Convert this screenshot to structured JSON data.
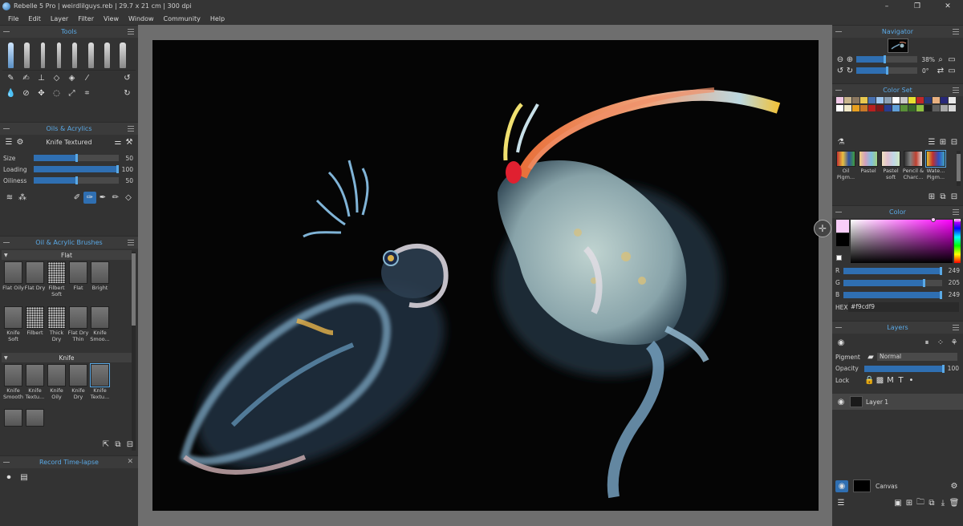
{
  "window": {
    "title": "Rebelle 5 Pro | weirdlilguys.reb | 29.7 x 21 cm | 300 dpi",
    "minimize": "–",
    "restore": "❐",
    "close": "✕"
  },
  "menu": [
    "File",
    "Edit",
    "Layer",
    "Filter",
    "View",
    "Window",
    "Community",
    "Help"
  ],
  "tools": {
    "title": "Tools"
  },
  "oils": {
    "title": "Oils & Acrylics",
    "preset": "Knife Textured",
    "sliders": [
      {
        "label": "Size",
        "value": "50",
        "pct": 0.5
      },
      {
        "label": "Loading",
        "value": "100",
        "pct": 1.0
      },
      {
        "label": "Oiliness",
        "value": "50",
        "pct": 0.5
      }
    ]
  },
  "brushes": {
    "title": "Oil & Acrylic Brushes",
    "categories": [
      {
        "name": "Flat",
        "items": [
          "Flat Oily",
          "Flat Dry",
          "Filbert Soft",
          "Flat",
          "Bright",
          "Knife Soft",
          "Filbert",
          "Thick Dry",
          "Flat Dry Thin",
          "Knife Smoo..."
        ]
      },
      {
        "name": "Knife",
        "items": [
          "Knife Smooth",
          "Knife Textu...",
          "Knife Oily",
          "Knife Dry",
          "Knife Textu..."
        ]
      }
    ]
  },
  "timelapse": {
    "title": "Record Time-lapse"
  },
  "navigator": {
    "title": "Navigator",
    "zoom": "38%",
    "rotation": "0°"
  },
  "colorset": {
    "title": "Color Set",
    "row1": [
      "#f0c8e6",
      "#c8b48c",
      "#8c7860",
      "#e8c850",
      "#4870b0",
      "#a0c8f0",
      "#8ca0b4",
      "#ffffff",
      "#c8c8c8",
      "#e8e030",
      "#c02828",
      "#283878",
      "#e8b080",
      "#282878",
      "#e8e8e8"
    ],
    "row2": [
      "#ffffff",
      "#f0e8c8",
      "#e8a020",
      "#c87828",
      "#b82020",
      "#801818",
      "#283c90",
      "#60a0d8",
      "#589038",
      "#386828",
      "#90c040",
      "#202020",
      "#606060",
      "#a8a8a8",
      "#d8d8d8"
    ],
    "sets": [
      "Oil Pigm...",
      "Pastel",
      "Pastel soft",
      "Pencil & Charc...",
      "Wate... Pigm..."
    ]
  },
  "color": {
    "title": "Color",
    "channels": [
      {
        "label": "R",
        "value": "249",
        "pct": 0.976
      },
      {
        "label": "G",
        "value": "205",
        "pct": 0.804
      },
      {
        "label": "B",
        "value": "249",
        "pct": 0.976
      }
    ],
    "hex_label": "HEX",
    "hex": "#f9cdf9",
    "current": "#f9cdf9"
  },
  "layers": {
    "title": "Layers",
    "pigment_label": "Pigment",
    "blend_mode": "Normal",
    "opacity_label": "Opacity",
    "opacity": "100",
    "lock_label": "Lock",
    "lock_letters": [
      "M",
      "T"
    ],
    "layer_name": "Layer 1",
    "canvas_label": "Canvas"
  }
}
